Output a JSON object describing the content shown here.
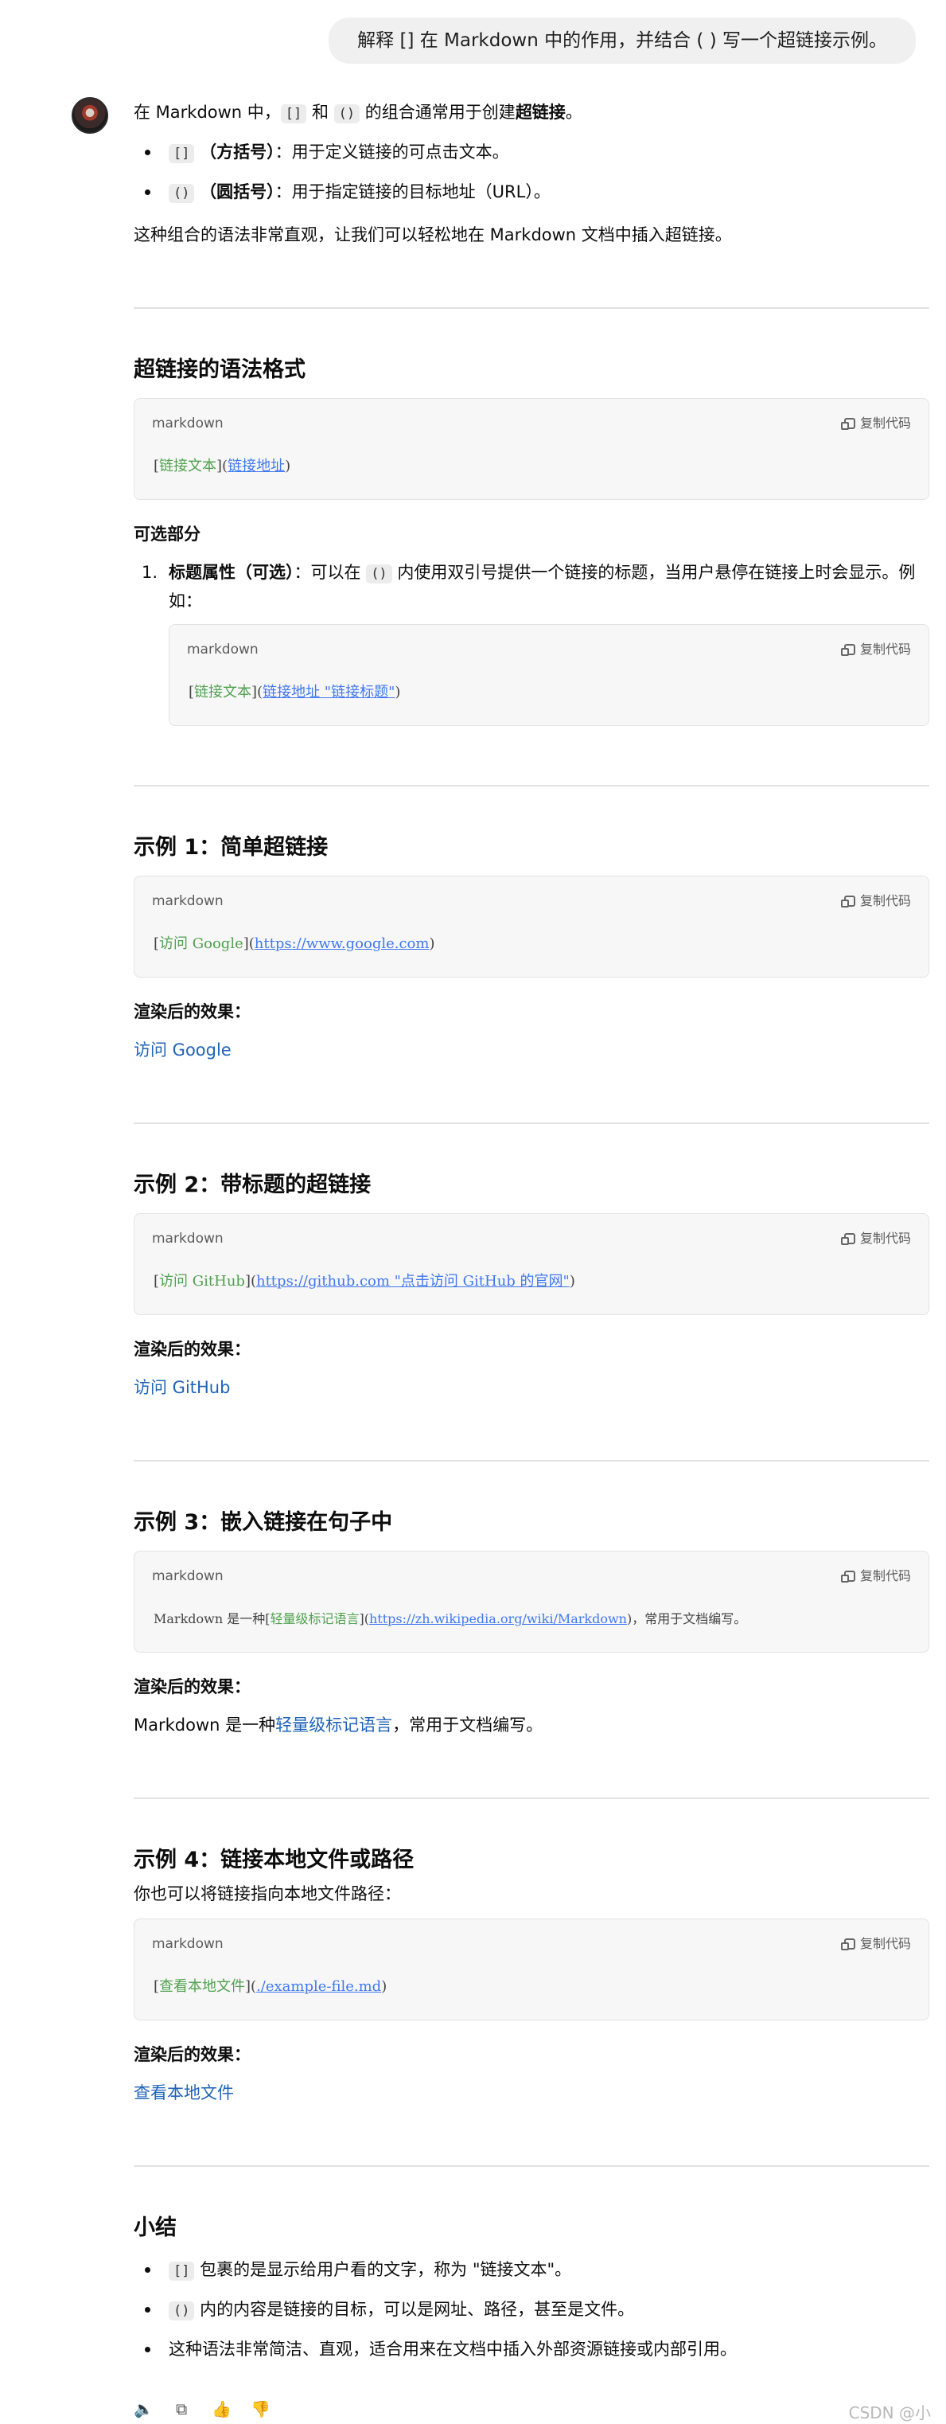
{
  "user_message": "解释 [] 在 Markdown 中的作用，并结合 ( ) 写一个超链接示例。",
  "intro": {
    "p1_a": "在 Markdown 中，",
    "p1_code1": "[]",
    "p1_b": " 和 ",
    "p1_code2": "()",
    "p1_c": " 的组合通常用于创建",
    "p1_bold": "超链接",
    "p1_d": "。",
    "bullets": [
      {
        "code": "[]",
        "bold": "（方括号）",
        "text": "：用于定义链接的可点击文本。"
      },
      {
        "code": "()",
        "bold": "（圆括号）",
        "text": "：用于指定链接的目标地址（URL）。"
      }
    ],
    "p2": "这种组合的语法非常直观，让我们可以轻松地在 Markdown 文档中插入超链接。"
  },
  "copy_label": "复制代码",
  "lang_label": "markdown",
  "section_syntax": {
    "title": "超链接的语法格式",
    "code": {
      "p1": "[",
      "text": "链接文本",
      "p2": "](",
      "url": "链接地址",
      "p3": ")"
    },
    "optional_title": "可选部分",
    "ol_num": "1.",
    "ol_bold": "标题属性（可选）",
    "ol_a": "：可以在 ",
    "ol_code": "()",
    "ol_b": " 内使用双引号提供一个链接的标题，当用户悬停在链接上时会显示。例如：",
    "code2": {
      "p1": "[",
      "text": "链接文本",
      "p2": "](",
      "url": "链接地址 \"链接标题\"",
      "p3": ")"
    }
  },
  "example1": {
    "title": "示例 1：简单超链接",
    "code": {
      "p1": "[",
      "text": "访问 Google",
      "p2": "](",
      "url": "https://www.google.com",
      "p3": ")"
    },
    "rendered_label": "渲染后的效果：",
    "rendered_link": "访问 Google"
  },
  "example2": {
    "title": "示例 2：带标题的超链接",
    "code": {
      "p1": "[",
      "text": "访问 GitHub",
      "p2": "](",
      "url": "https://github.com \"点击访问 GitHub 的官网\"",
      "p3": ")"
    },
    "rendered_label": "渲染后的效果：",
    "rendered_link": "访问 GitHub"
  },
  "example3": {
    "title": "示例 3：嵌入链接在句子中",
    "code": {
      "pre": "Markdown 是一种",
      "p1": "[",
      "text": "轻量级标记语言",
      "p2": "](",
      "url": "https://zh.wikipedia.org/wiki/Markdown",
      "p3": ")，常用于文档编写。"
    },
    "rendered_label": "渲染后的效果：",
    "rendered_pre": "Markdown 是一种",
    "rendered_link": "轻量级标记语言",
    "rendered_post": "，常用于文档编写。"
  },
  "example4": {
    "title": "示例 4：链接本地文件或路径",
    "desc": "你也可以将链接指向本地文件路径：",
    "code": {
      "p1": "[",
      "text": "查看本地文件",
      "p2": "](",
      "url": "./example-file.md",
      "p3": ")"
    },
    "rendered_label": "渲染后的效果：",
    "rendered_link": "查看本地文件"
  },
  "summary": {
    "title": "小结",
    "items": [
      {
        "code": "[]",
        "text": " 包裹的是显示给用户看的文字，称为 \"链接文本\"。"
      },
      {
        "code": "()",
        "text": " 内的内容是链接的目标，可以是网址、路径，甚至是文件。"
      },
      {
        "code": "",
        "text": "这种语法非常简洁、直观，适合用来在文档中插入外部资源链接或内部引用。"
      }
    ]
  },
  "watermark": "CSDN @小",
  "icons": [
    "speaker-icon",
    "copy-icon",
    "thumbs-up-icon",
    "thumbs-down-icon"
  ]
}
